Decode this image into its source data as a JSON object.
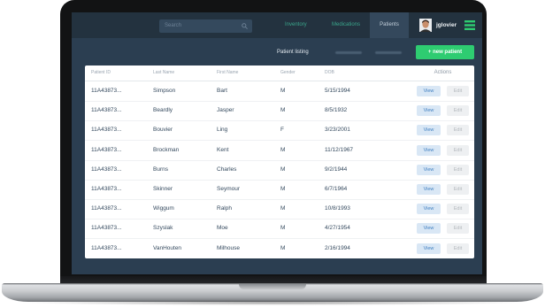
{
  "nav": {
    "search_placeholder": "Search",
    "items": [
      {
        "label": "Inventory",
        "active": false
      },
      {
        "label": "Medications",
        "active": false
      },
      {
        "label": "Patients",
        "active": true
      }
    ],
    "username": "jglovier"
  },
  "toolbar": {
    "title": "Patient listing",
    "new_button": "+ new patient"
  },
  "table": {
    "headers": [
      "Patient ID",
      "Last Name",
      "First Name",
      "Gender",
      "DOB",
      "Actions"
    ],
    "rows": [
      {
        "id": "11A43873...",
        "last_name": "Simpson",
        "first_name": "Bart",
        "gender": "M",
        "dob": "5/15/1994"
      },
      {
        "id": "11A43873...",
        "last_name": "Beardly",
        "first_name": "Jasper",
        "gender": "M",
        "dob": "8/5/1932"
      },
      {
        "id": "11A43873...",
        "last_name": "Bouvier",
        "first_name": "Ling",
        "gender": "F",
        "dob": "3/23/2001"
      },
      {
        "id": "11A43873...",
        "last_name": "Brockman",
        "first_name": "Kent",
        "gender": "M",
        "dob": "11/12/1967"
      },
      {
        "id": "11A43873...",
        "last_name": "Burns",
        "first_name": "Charles",
        "gender": "M",
        "dob": "9/2/1944"
      },
      {
        "id": "11A43873...",
        "last_name": "Skinner",
        "first_name": "Seymour",
        "gender": "M",
        "dob": "6/7/1964"
      },
      {
        "id": "11A43873...",
        "last_name": "Wiggum",
        "first_name": "Ralph",
        "gender": "M",
        "dob": "10/8/1993"
      },
      {
        "id": "11A43873...",
        "last_name": "Szyslak",
        "first_name": "Moe",
        "gender": "M",
        "dob": "4/27/1954"
      },
      {
        "id": "11A43873...",
        "last_name": "VanHouten",
        "first_name": "Milhouse",
        "gender": "M",
        "dob": "2/16/1994"
      }
    ],
    "view_label": "View",
    "edit_label": "Edit"
  },
  "icons": {
    "search": "search-icon",
    "menu": "hamburger-menu-icon",
    "avatar": "user-avatar"
  },
  "colors": {
    "screen_bg": "#2b3e51",
    "nav_bg": "#23323f",
    "nav_link": "#3aa68b",
    "accent_green": "#2ecc71",
    "view_button_bg": "#d9e7f5",
    "edit_button_bg": "#eef0f2"
  }
}
